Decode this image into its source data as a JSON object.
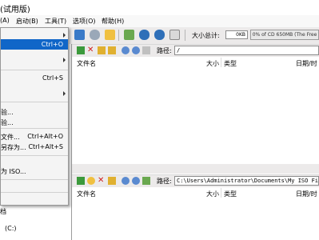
{
  "window": {
    "title": "(试用版)"
  },
  "menubar": {
    "items": [
      {
        "label": "(A)"
      },
      {
        "label": "启动(B)"
      },
      {
        "label": "工具(T)"
      },
      {
        "label": "选项(O)"
      },
      {
        "label": "帮助(H)"
      }
    ]
  },
  "toolbar": {
    "size_label": "大小总计:",
    "size_value": "0KB",
    "progress_text": "0% of CD 650MB (The Free"
  },
  "dropdown": {
    "items": [
      {
        "label": "",
        "shortcut": "",
        "submenu": true
      },
      {
        "label": "",
        "shortcut": "Ctrl+O",
        "highlighted": true
      },
      {
        "label": "",
        "shortcut": "",
        "submenu": true
      },
      {
        "label": "",
        "shortcut": "Ctrl+S"
      },
      {
        "label": "",
        "shortcut": "",
        "submenu": true
      },
      {
        "label": "验...",
        "shortcut": ""
      },
      {
        "label": "验...",
        "shortcut": ""
      },
      {
        "label": "文件...",
        "shortcut": "Ctrl+Alt+O"
      },
      {
        "label": "另存为...",
        "shortcut": "Ctrl+Alt+S"
      },
      {
        "label": "为 ISO...",
        "shortcut": ""
      }
    ]
  },
  "tree": {
    "items": [
      {
        "label": "档"
      },
      {
        "label": "(C:)"
      }
    ]
  },
  "top_pane": {
    "path_label": "路径:",
    "path_value": "/",
    "columns": [
      "文件名",
      "大小",
      "类型",
      "日期/时"
    ]
  },
  "bottom_pane": {
    "path_label": "路径:",
    "path_value": "C:\\Users\\Administrator\\Documents\\My ISO Files",
    "columns": [
      "文件名",
      "大小",
      "类型",
      "日期/时"
    ]
  }
}
